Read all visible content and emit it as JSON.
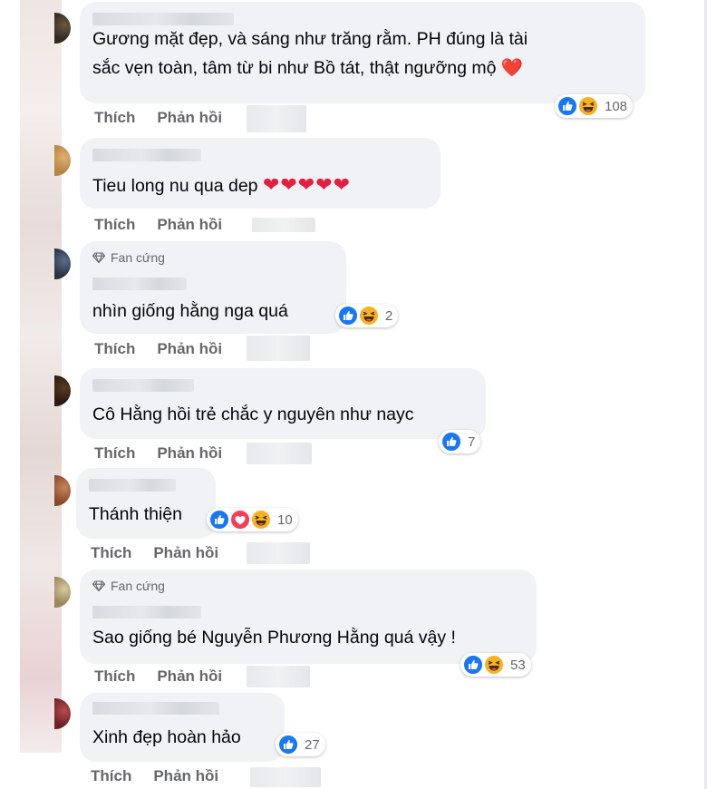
{
  "comments": [
    {
      "text_lines": [
        "Gương mặt đẹp, và sáng như trăng rằm. PH đúng là tài",
        "sắc vẹn toàn, tâm từ bi như Bồ tát, thật ngưỡng mộ ❤️"
      ],
      "reactions": [
        "like-icon",
        "haha-icon"
      ],
      "reaction_count": "108",
      "like_label": "Thích",
      "reply_label": "Phản hồi"
    },
    {
      "text": "Tieu long nu qua dep",
      "hearts": "❤❤❤❤❤",
      "like_label": "Thích",
      "reply_label": "Phản hồi"
    },
    {
      "badge": "Fan cứng",
      "text": "nhìn giống hằng nga quá",
      "reactions": [
        "like-icon",
        "haha-icon"
      ],
      "reaction_count": "2",
      "like_label": "Thích",
      "reply_label": "Phản hồi"
    },
    {
      "text": "Cô Hằng hồi trẻ chắc y nguyên như nayc",
      "reactions": [
        "like-icon"
      ],
      "reaction_count": "7",
      "like_label": "Thích",
      "reply_label": "Phản hồi"
    },
    {
      "text": "Thánh thiện",
      "reactions": [
        "like-icon",
        "love-icon",
        "haha-icon"
      ],
      "reaction_count": "10",
      "like_label": "Thích",
      "reply_label": "Phản hồi"
    },
    {
      "badge": "Fan cứng",
      "text": "Sao giống bé Nguyễn Phương Hằng quá vậy !",
      "reactions": [
        "like-icon",
        "haha-icon"
      ],
      "reaction_count": "53",
      "like_label": "Thích",
      "reply_label": "Phản hồi"
    },
    {
      "text": "Xinh đẹp hoàn hảo",
      "reactions": [
        "like-icon"
      ],
      "reaction_count": "27",
      "like_label": "Thích",
      "reply_label": "Phản hồi"
    }
  ],
  "colors": {
    "bubble": "#f0f2f5",
    "text": "#050505",
    "muted": "#65676b",
    "like": "#1877f2",
    "haha": "#f7b125",
    "love": "#f33e58"
  }
}
